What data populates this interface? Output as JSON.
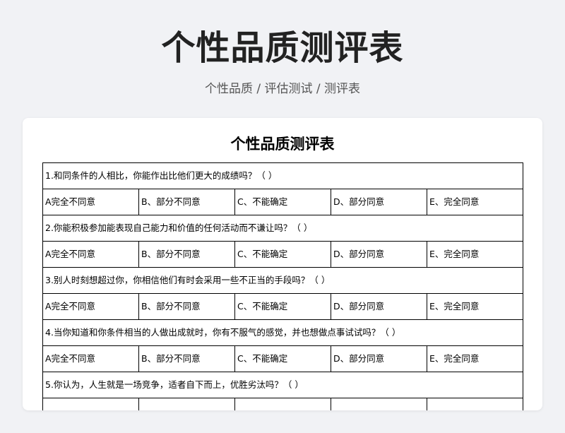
{
  "header": {
    "title": "个性品质测评表",
    "breadcrumb": "个性品质 / 评估测试 / 测评表"
  },
  "document": {
    "title": "个性品质测评表",
    "questions": [
      {
        "text": "1.和同条件的人相比，你能作出比他们更大的成绩吗？（     ）",
        "options": [
          "A完全不同意",
          "B、部分不同意",
          "C、不能确定",
          "D、部分同意",
          "E、完全同意"
        ]
      },
      {
        "text": "2.你能积极参加能表现自己能力和价值的任何活动而不谦让吗？（     ）",
        "options": [
          "A完全不同意",
          "B、部分不同意",
          "C、不能确定",
          "D、部分同意",
          "E、完全同意"
        ]
      },
      {
        "text": "3.别人时刻想超过你，你相信他们有时会采用一些不正当的手段吗？（     ）",
        "options": [
          "A完全不同意",
          "B、部分不同意",
          "C、不能确定",
          "D、部分同意",
          "E、完全同意"
        ]
      },
      {
        "text": "4.当你知道和你条件相当的人做出成就时，你有不服气的感觉，并也想做点事试试吗？（     ）",
        "options": [
          "A完全不同意",
          "B、部分不同意",
          "C、不能确定",
          "D、部分同意",
          "E、完全同意"
        ]
      },
      {
        "text": "5.你认为，人生就是一场竞争，适者自下而上，优胜劣汰吗？（     ）",
        "options": [
          "",
          "",
          "",
          "",
          ""
        ]
      }
    ]
  }
}
